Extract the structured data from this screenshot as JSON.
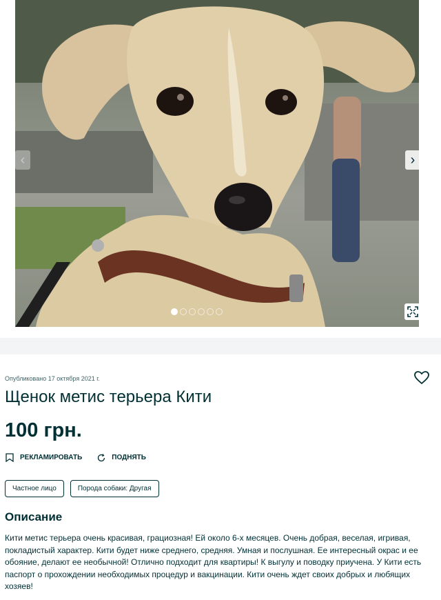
{
  "gallery": {
    "image_alt": "Щенок метис терьера Кити",
    "prev_icon": "chevron-left-icon",
    "next_icon": "chevron-right-icon",
    "fullscreen_icon": "expand-icon",
    "dot_count": 6,
    "active_dot": 1
  },
  "ad": {
    "published": "Опубликовано 17 октября 2021 г.",
    "title": "Щенок метис терьера Кити",
    "price": "100 грн.",
    "favorite_icon": "heart-icon"
  },
  "actions": {
    "promote_label": "РЕКЛАМИРОВАТЬ",
    "raise_label": "ПОДНЯТЬ"
  },
  "tags": [
    "Частное лицо",
    "Порода собаки: Другая"
  ],
  "description": {
    "title": "Описание",
    "text": "Кити метис терьера очень красивая, грациозная! Ей около 6-х месяцев. Очень добрая, веселая, игривая, покладистый характер. Кити будет ниже среднего, средняя. Умная и послушная. Ее интересный окрас и ее обояние, делают ее необычной! Отлично подходит для квартиры! К выгулу и поводку приучена. У Кити есть паспорт о прохождении необходимых процедур и вакцинации. Кити очень ждет своих добрых и любящих хозяев!"
  },
  "colors": {
    "text": "#002f34",
    "separator": "#f2f4f5"
  }
}
